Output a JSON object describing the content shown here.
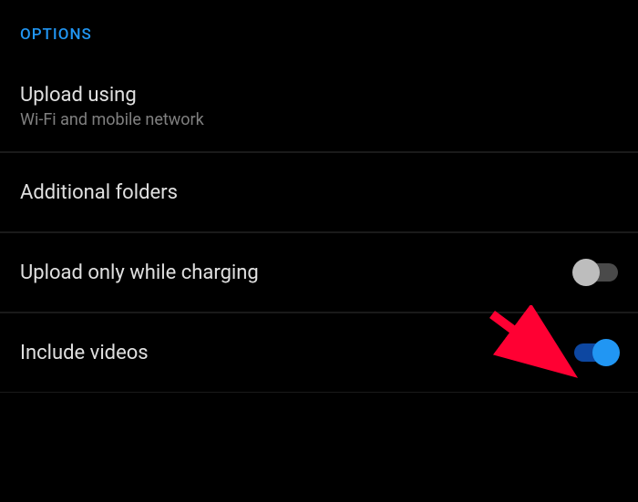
{
  "section_header": "OPTIONS",
  "rows": {
    "upload_using": {
      "title": "Upload using",
      "subtitle": "Wi-Fi and mobile network"
    },
    "additional_folders": {
      "title": "Additional folders"
    },
    "upload_charging": {
      "title": "Upload only while charging",
      "toggle_state": "off"
    },
    "include_videos": {
      "title": "Include videos",
      "toggle_state": "on"
    }
  }
}
